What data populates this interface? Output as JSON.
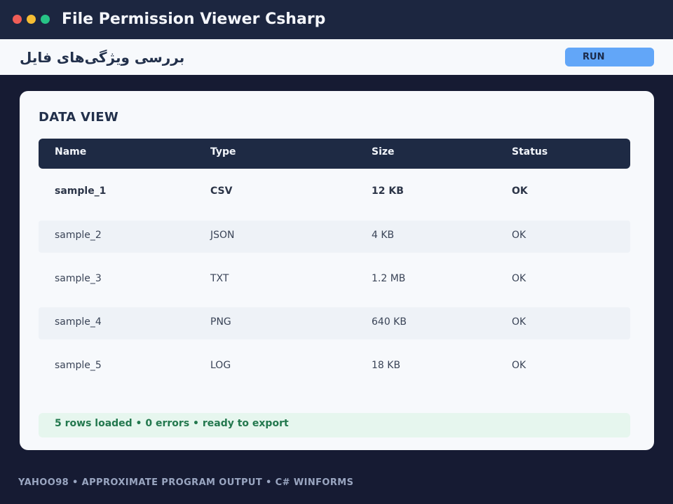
{
  "window": {
    "title": "File Permission Viewer Csharp",
    "controls": [
      {
        "name": "close",
        "color": "#ef5d57"
      },
      {
        "name": "minimize",
        "color": "#f5bd33"
      },
      {
        "name": "maximize",
        "color": "#27c386"
      }
    ]
  },
  "toolbar": {
    "title": "بررسی ویژگی‌های فایل",
    "run_label": "RUN"
  },
  "main": {
    "section_title": "DATA VIEW",
    "columns": [
      "Name",
      "Type",
      "Size",
      "Status"
    ],
    "rows": [
      {
        "name": "sample_1",
        "type": "CSV",
        "size": "12 KB",
        "status": "OK"
      },
      {
        "name": "sample_2",
        "type": "JSON",
        "size": "4 KB",
        "status": "OK"
      },
      {
        "name": "sample_3",
        "type": "TXT",
        "size": "1.2 MB",
        "status": "OK"
      },
      {
        "name": "sample_4",
        "type": "PNG",
        "size": "640 KB",
        "status": "OK"
      },
      {
        "name": "sample_5",
        "type": "LOG",
        "size": "18 KB",
        "status": "OK"
      }
    ],
    "status_message": "5 rows loaded  •  0 errors  •  ready to export"
  },
  "footer": {
    "text": "YAHOO98  •  APPROXIMATE PROGRAM OUTPUT  •  C# WINFORMS"
  },
  "colors": {
    "background": "#161b33",
    "titlebar": "#1c2640",
    "accent": "#62a6f8",
    "table_header": "#1e2a44",
    "status_ok_bg": "#e6f6ee",
    "status_ok_text": "#23784e"
  }
}
